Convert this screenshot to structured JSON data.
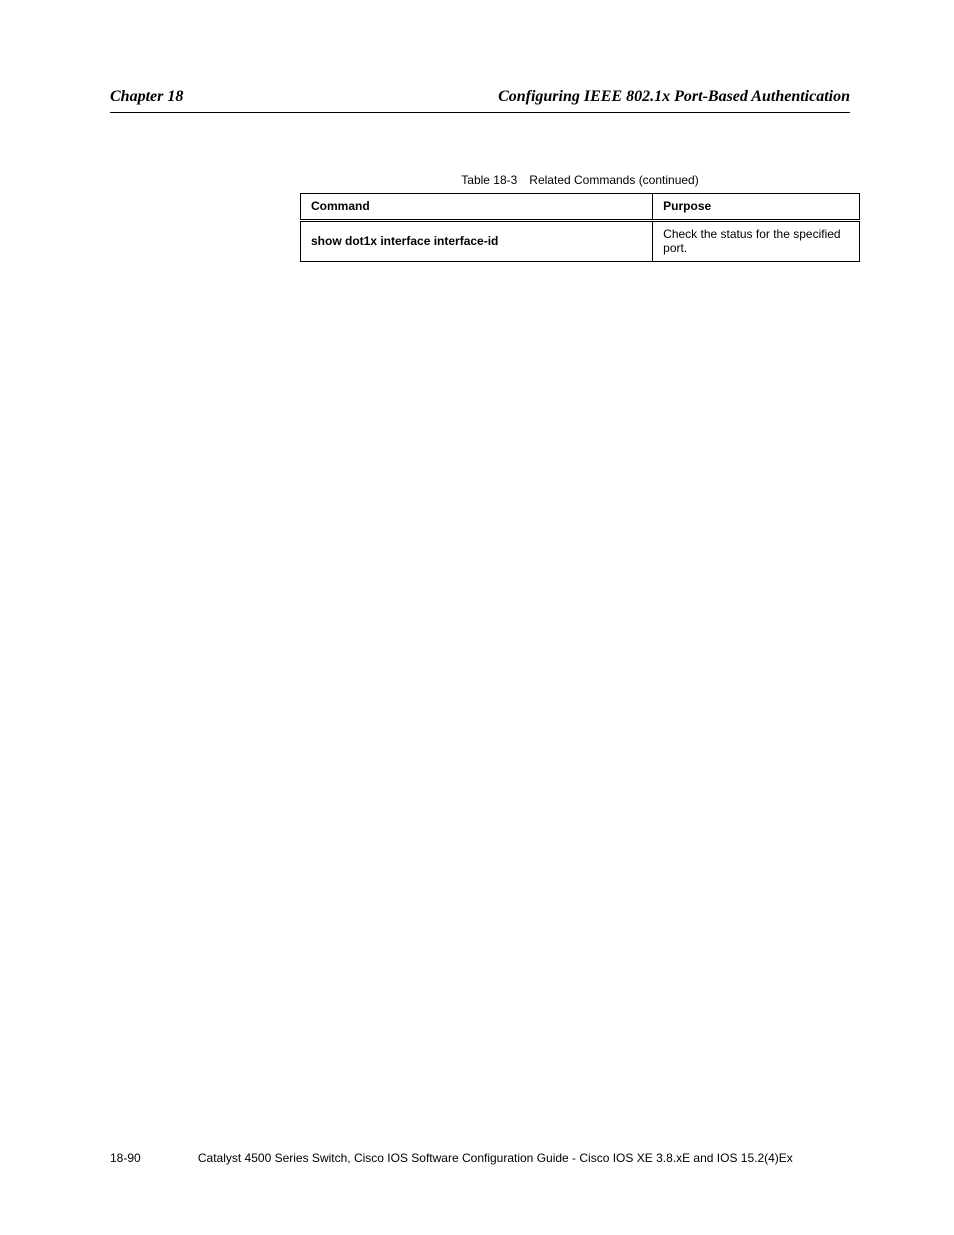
{
  "header": {
    "left": "Chapter 18",
    "right": "Configuring IEEE 802.1x Port-Based Authentication"
  },
  "table": {
    "caption": "Table 18-3 Related Commands (continued)",
    "headers": [
      "Command",
      "Purpose"
    ],
    "rows": [
      [
        "show dot1x interface interface-id",
        "Check the status for the specified port."
      ]
    ]
  },
  "footer": {
    "left": "18-90",
    "center": "Catalyst 4500 Series Switch, Cisco IOS Software Configuration Guide - Cisco IOS XE 3.8.xE and IOS 15.2(4)Ex",
    "right": ""
  }
}
